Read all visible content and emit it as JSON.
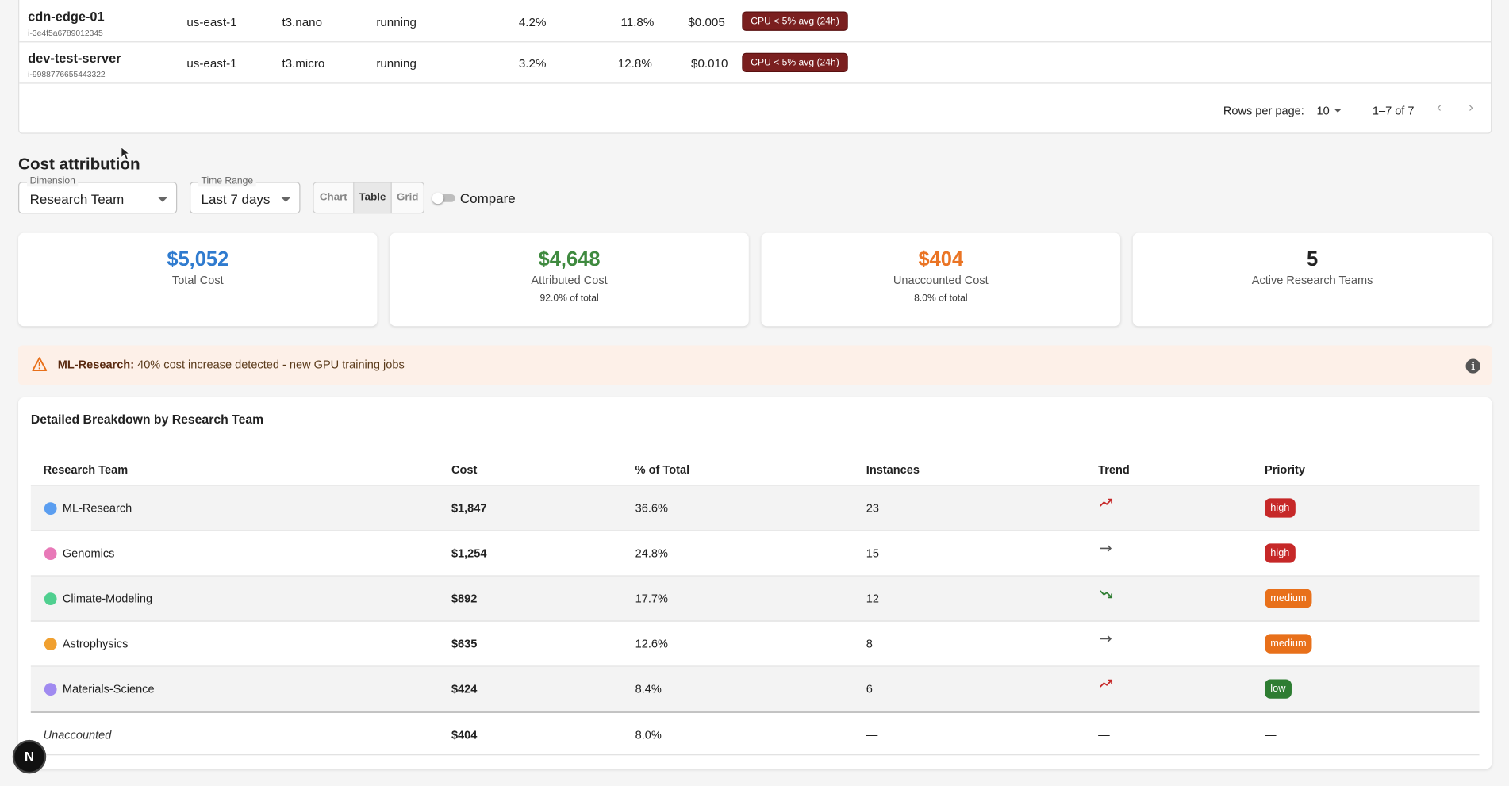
{
  "instances": {
    "rows": [
      {
        "name": "cdn-edge-01",
        "id": "i-3e4f5a6789012345",
        "region": "us-east-1",
        "type": "t3.nano",
        "state": "running",
        "cpu": "4.2%",
        "mem": "11.8%",
        "cost": "$0.005",
        "badge": "CPU < 5% avg (24h)"
      },
      {
        "name": "dev-test-server",
        "id": "i-9988776655443322",
        "region": "us-east-1",
        "type": "t3.micro",
        "state": "running",
        "cpu": "3.2%",
        "mem": "12.8%",
        "cost": "$0.010",
        "badge": "CPU < 5% avg (24h)"
      }
    ],
    "pagination": {
      "rows_per_page_label": "Rows per page:",
      "rows_per_page": "10",
      "range": "1–7 of 7"
    }
  },
  "cost_attribution": {
    "title": "Cost attribution",
    "dimension": {
      "label": "Dimension",
      "value": "Research Team"
    },
    "time_range": {
      "label": "Time Range",
      "value": "Last 7 days"
    },
    "view_options": [
      "Chart",
      "Table",
      "Grid"
    ],
    "active_view": "Table",
    "compare_label": "Compare",
    "compare_on": false
  },
  "summary": [
    {
      "value": "$5,052",
      "title": "Total Cost",
      "sub": "",
      "color": "#2f7bcf"
    },
    {
      "value": "$4,648",
      "title": "Attributed Cost",
      "sub": "92.0% of total",
      "color": "#3f8a3f"
    },
    {
      "value": "$404",
      "title": "Unaccounted Cost",
      "sub": "8.0% of total",
      "color": "#ea7424"
    },
    {
      "value": "5",
      "title": "Active Research Teams",
      "sub": "",
      "color": "#222222"
    }
  ],
  "alert": {
    "team": "ML-Research:",
    "message": "40% cost increase detected - new GPU training jobs",
    "icon": "warning-icon"
  },
  "breakdown": {
    "title": "Detailed Breakdown by Research Team",
    "headers": [
      "Research Team",
      "Cost",
      "% of Total",
      "Instances",
      "Trend",
      "Priority"
    ],
    "rows": [
      {
        "team": "ML-Research",
        "color": "#5b9ef0",
        "cost": "$1,847",
        "pct": "36.6%",
        "instances": "23",
        "trend": "up",
        "priority": "high",
        "priority_color": "#c62828"
      },
      {
        "team": "Genomics",
        "color": "#e879b8",
        "cost": "$1,254",
        "pct": "24.8%",
        "instances": "15",
        "trend": "flat",
        "priority": "high",
        "priority_color": "#c62828"
      },
      {
        "team": "Climate-Modeling",
        "color": "#4fcf8f",
        "cost": "$892",
        "pct": "17.7%",
        "instances": "12",
        "trend": "down",
        "priority": "medium",
        "priority_color": "#e8701a"
      },
      {
        "team": "Astrophysics",
        "color": "#f0a030",
        "cost": "$635",
        "pct": "12.6%",
        "instances": "8",
        "trend": "flat",
        "priority": "medium",
        "priority_color": "#e8701a"
      },
      {
        "team": "Materials-Science",
        "color": "#a08af0",
        "cost": "$424",
        "pct": "8.4%",
        "instances": "6",
        "trend": "up",
        "priority": "low",
        "priority_color": "#2e7d32"
      }
    ],
    "unaccounted": {
      "team": "Unaccounted",
      "cost": "$404",
      "pct": "8.0%",
      "instances": "—",
      "trend": "—",
      "priority": "—"
    }
  },
  "nextjs_badge": "N"
}
